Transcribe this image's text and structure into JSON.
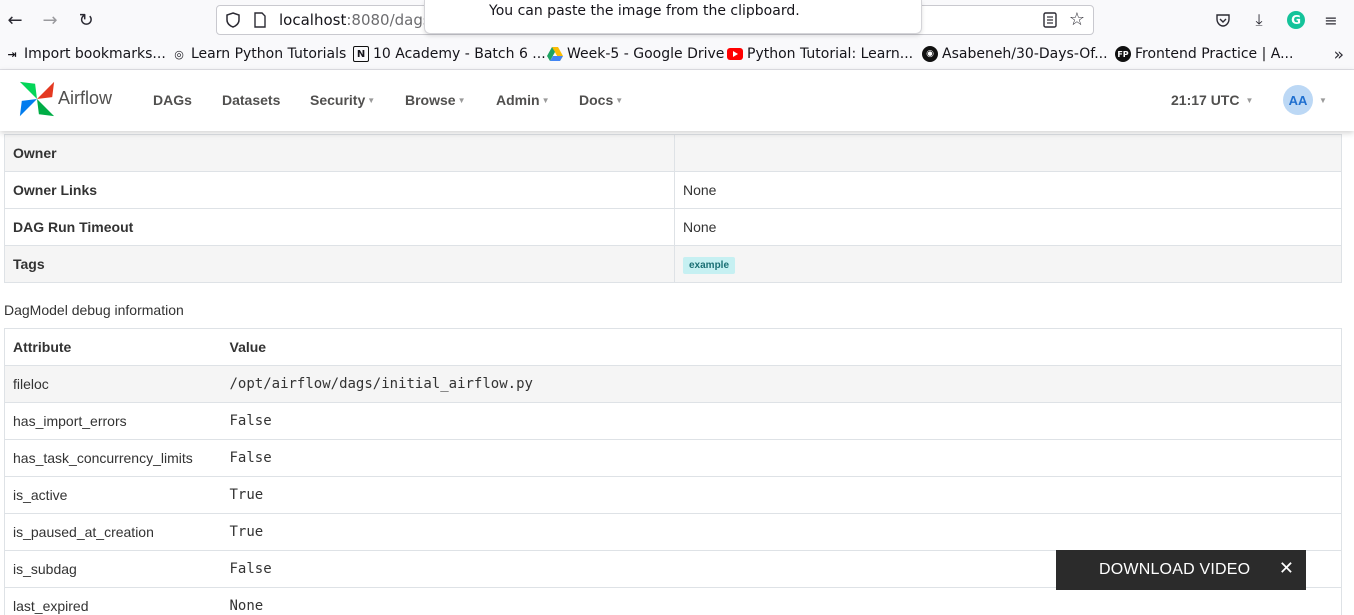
{
  "browser": {
    "url_host": "localhost",
    "url_rest": ":8080/dags/",
    "tooltip": "You can paste the image from the clipboard."
  },
  "bookmarks": [
    {
      "label": "Import bookmarks...",
      "icon": "import-icon"
    },
    {
      "label": "Learn Python Tutorials",
      "icon": "globe-icon"
    },
    {
      "label": "10 Academy - Batch 6 ...",
      "icon": "notion-icon"
    },
    {
      "label": "Week-5 - Google Drive",
      "icon": "google-drive-icon"
    },
    {
      "label": "Python Tutorial: Learn...",
      "icon": "youtube-icon"
    },
    {
      "label": "Asabeneh/30-Days-Of...",
      "icon": "github-icon"
    },
    {
      "label": "Frontend Practice | A...",
      "icon": "fp-icon"
    }
  ],
  "airflow": {
    "brand": "Airflow",
    "menu": {
      "dags": "DAGs",
      "datasets": "Datasets",
      "security": "Security",
      "browse": "Browse",
      "admin": "Admin",
      "docs": "Docs"
    },
    "time": "21:17 UTC",
    "avatar": "AA"
  },
  "dag_details": [
    {
      "key": "Owner",
      "value": ""
    },
    {
      "key": "Owner Links",
      "value": "None"
    },
    {
      "key": "DAG Run Timeout",
      "value": "None"
    },
    {
      "key": "Tags",
      "value": "example"
    }
  ],
  "dagmodel": {
    "title": "DagModel debug information",
    "headers": {
      "attribute": "Attribute",
      "value": "Value"
    },
    "rows": [
      {
        "attribute": "fileloc",
        "value": "/opt/airflow/dags/initial_airflow.py"
      },
      {
        "attribute": "has_import_errors",
        "value": "False"
      },
      {
        "attribute": "has_task_concurrency_limits",
        "value": "False"
      },
      {
        "attribute": "is_active",
        "value": "True"
      },
      {
        "attribute": "is_paused_at_creation",
        "value": "True"
      },
      {
        "attribute": "is_subdag",
        "value": "False"
      },
      {
        "attribute": "last_expired",
        "value": "None"
      }
    ]
  },
  "download_bar": {
    "label": "DOWNLOAD VIDEO",
    "close": "✕"
  },
  "colors": {
    "airflow_brand_text": "#51504f",
    "tag_bg": "#c6f0f2",
    "grammarly": "#15c39a"
  }
}
